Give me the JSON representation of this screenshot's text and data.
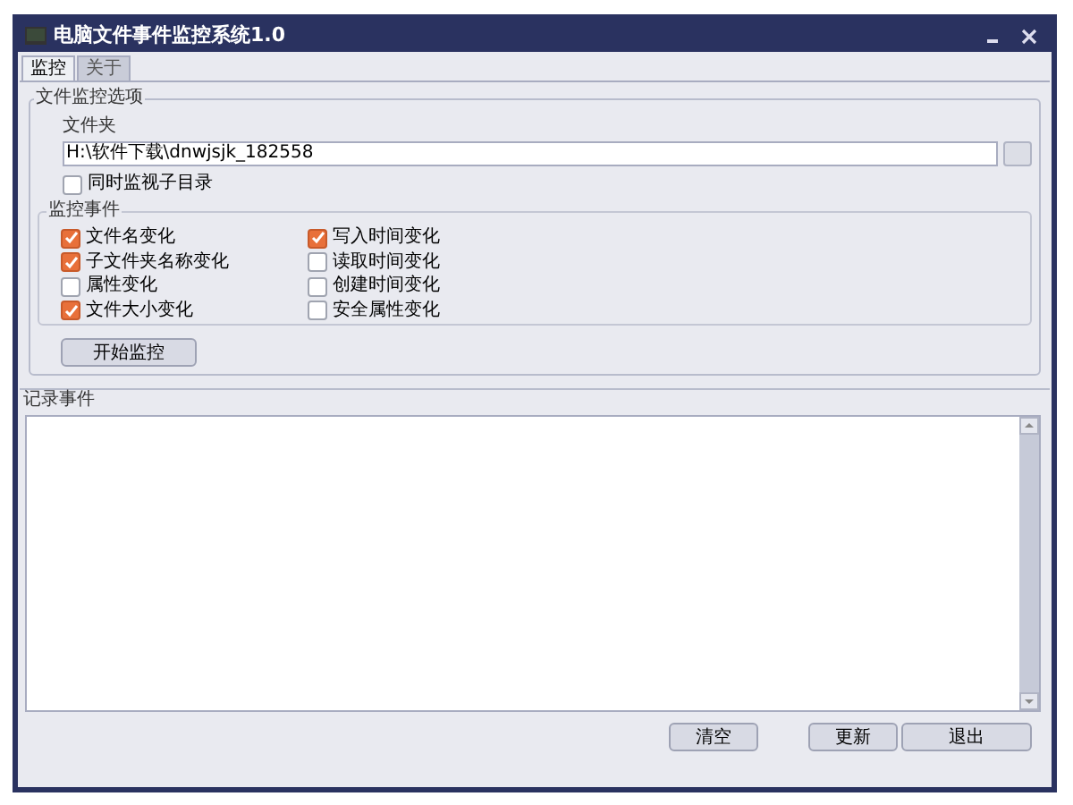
{
  "window": {
    "title": "电脑文件事件监控系统1.0"
  },
  "tabs": [
    {
      "label": "监控",
      "selected": true
    },
    {
      "label": "关于",
      "selected": false
    }
  ],
  "options": {
    "title": "文件监控选项",
    "folder_label": "文件夹",
    "folder_value": "H:\\软件下载\\dnwjsjk_182558",
    "subdirs": {
      "label": "同时监视子目录",
      "checked": false
    },
    "events_title": "监控事件",
    "events": [
      {
        "label": "文件名变化",
        "checked": true
      },
      {
        "label": "子文件夹名称变化",
        "checked": true
      },
      {
        "label": "属性变化",
        "checked": false
      },
      {
        "label": "文件大小变化",
        "checked": true
      },
      {
        "label": "写入时间变化",
        "checked": true
      },
      {
        "label": "读取时间变化",
        "checked": false
      },
      {
        "label": "创建时间变化",
        "checked": false
      },
      {
        "label": "安全属性变化",
        "checked": false
      }
    ],
    "start_button": "开始监控"
  },
  "log": {
    "title": "记录事件"
  },
  "buttons": [
    "清空",
    "更新",
    "退出"
  ]
}
